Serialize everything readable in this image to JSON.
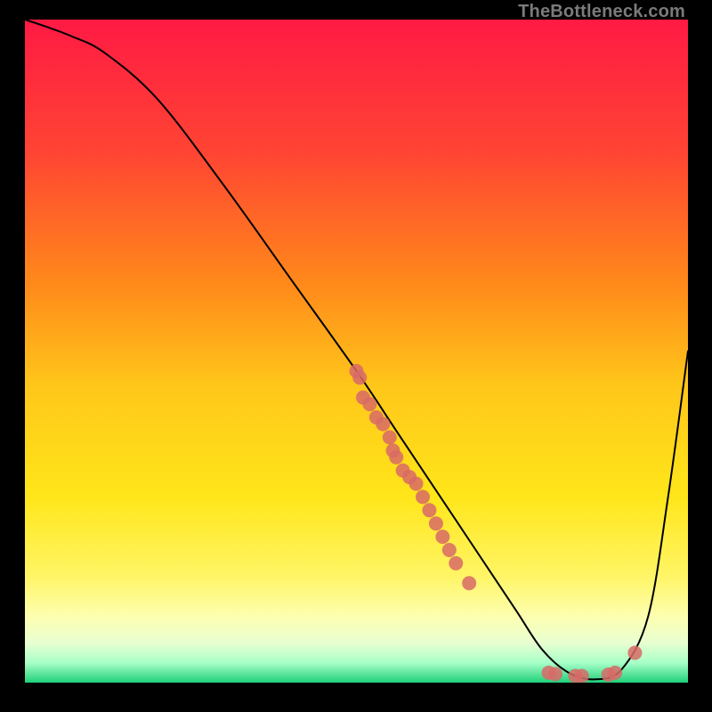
{
  "attribution": "TheBottleneck.com",
  "chart_data": {
    "type": "line",
    "title": "",
    "xlabel": "",
    "ylabel": "",
    "xlim": [
      0,
      100
    ],
    "ylim": [
      0,
      100
    ],
    "grid": false,
    "legend": false,
    "gradient_stops": [
      {
        "offset": 0.0,
        "color": "#ff1a44"
      },
      {
        "offset": 0.2,
        "color": "#ff4433"
      },
      {
        "offset": 0.4,
        "color": "#ff8a1a"
      },
      {
        "offset": 0.55,
        "color": "#ffc61a"
      },
      {
        "offset": 0.72,
        "color": "#ffe61a"
      },
      {
        "offset": 0.84,
        "color": "#fff566"
      },
      {
        "offset": 0.9,
        "color": "#fdffb0"
      },
      {
        "offset": 0.94,
        "color": "#e8ffd1"
      },
      {
        "offset": 0.97,
        "color": "#a8ffc8"
      },
      {
        "offset": 1.0,
        "color": "#1fd07a"
      }
    ],
    "series": [
      {
        "name": "curve",
        "x": [
          0,
          3,
          7,
          12,
          20,
          30,
          40,
          50,
          56,
          62,
          68,
          74,
          78,
          82,
          86,
          90,
          94,
          97,
          100
        ],
        "y": [
          100,
          99,
          97.5,
          95,
          88,
          75,
          61,
          47,
          38,
          29,
          20,
          11,
          5,
          1.5,
          0.5,
          2,
          10,
          28,
          50
        ]
      }
    ],
    "points": {
      "name": "markers",
      "color": "#d86a66",
      "radius": 8,
      "data": [
        {
          "x": 50,
          "y": 47
        },
        {
          "x": 50.5,
          "y": 46
        },
        {
          "x": 51,
          "y": 43
        },
        {
          "x": 52,
          "y": 42
        },
        {
          "x": 53,
          "y": 40
        },
        {
          "x": 54,
          "y": 39
        },
        {
          "x": 55,
          "y": 37
        },
        {
          "x": 55.5,
          "y": 35
        },
        {
          "x": 56,
          "y": 34
        },
        {
          "x": 57,
          "y": 32
        },
        {
          "x": 58,
          "y": 31
        },
        {
          "x": 59,
          "y": 30
        },
        {
          "x": 60,
          "y": 28
        },
        {
          "x": 61,
          "y": 26
        },
        {
          "x": 62,
          "y": 24
        },
        {
          "x": 63,
          "y": 22
        },
        {
          "x": 64,
          "y": 20
        },
        {
          "x": 65,
          "y": 18
        },
        {
          "x": 67,
          "y": 15
        },
        {
          "x": 79,
          "y": 1.5
        },
        {
          "x": 80,
          "y": 1.3
        },
        {
          "x": 83,
          "y": 1.0
        },
        {
          "x": 84,
          "y": 1.0
        },
        {
          "x": 88,
          "y": 1.2
        },
        {
          "x": 89,
          "y": 1.5
        },
        {
          "x": 92,
          "y": 4.5
        }
      ]
    }
  }
}
